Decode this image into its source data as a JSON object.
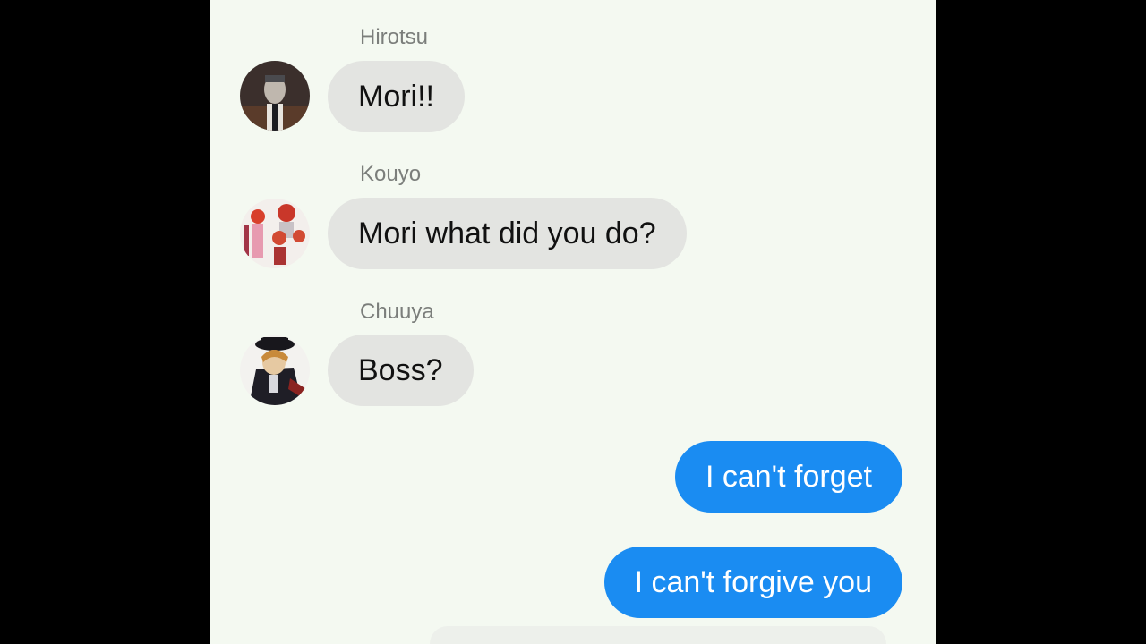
{
  "conversation": {
    "incoming": [
      {
        "sender": "Hirotsu",
        "text": "Mori!!",
        "avatar_icon": "hirotsu-avatar-icon"
      },
      {
        "sender": "Kouyo",
        "text": "Mori what did you do?",
        "avatar_icon": "kouyo-avatar-icon"
      },
      {
        "sender": "Chuuya",
        "text": "Boss?",
        "avatar_icon": "chuuya-avatar-icon"
      }
    ],
    "outgoing": [
      {
        "text": "I can't forget"
      },
      {
        "text": "I can't forgive you"
      }
    ]
  },
  "colors": {
    "background": "#f4f9f1",
    "incoming_bubble": "#e3e4e1",
    "outgoing_bubble": "#1a8cf2",
    "outgoing_text": "#ffffff",
    "sender_name": "#7b7e7b"
  }
}
